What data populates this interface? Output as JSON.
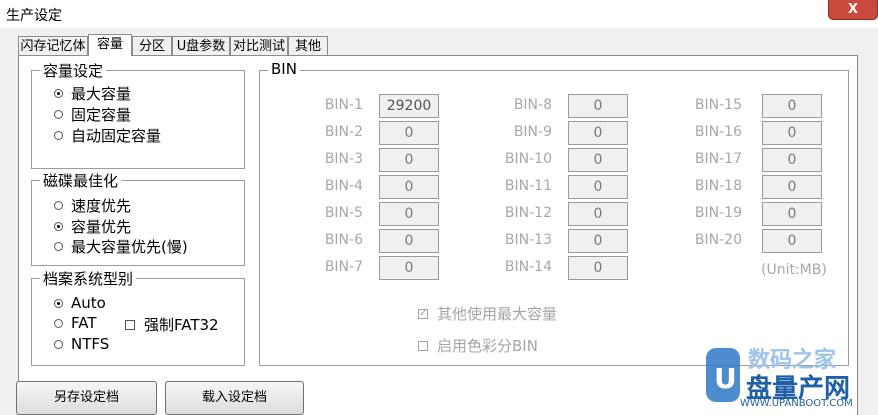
{
  "window": {
    "title": "生产设定",
    "close_glyph": "X"
  },
  "tabs": [
    "闪存记忆体",
    "容量",
    "分区",
    "U盘参数",
    "对比测试",
    "其他"
  ],
  "active_tab": 1,
  "capacity_group": {
    "title": "容量设定",
    "options": [
      "最大容量",
      "固定容量",
      "自动固定容量"
    ],
    "selected": 0
  },
  "optimize_group": {
    "title": "磁碟最佳化",
    "options": [
      "速度优先",
      "容量优先",
      "最大容量优先(慢)"
    ],
    "selected": 1
  },
  "fs_group": {
    "title": "档案系统型别",
    "options": [
      "Auto",
      "FAT",
      "NTFS"
    ],
    "selected": 0,
    "force_fat32_label": "强制FAT32"
  },
  "bin_group": {
    "title": "BIN",
    "bins": [
      {
        "label": "BIN-1",
        "value": "29200"
      },
      {
        "label": "BIN-2",
        "value": "0"
      },
      {
        "label": "BIN-3",
        "value": "0"
      },
      {
        "label": "BIN-4",
        "value": "0"
      },
      {
        "label": "BIN-5",
        "value": "0"
      },
      {
        "label": "BIN-6",
        "value": "0"
      },
      {
        "label": "BIN-7",
        "value": "0"
      },
      {
        "label": "BIN-8",
        "value": "0"
      },
      {
        "label": "BIN-9",
        "value": "0"
      },
      {
        "label": "BIN-10",
        "value": "0"
      },
      {
        "label": "BIN-11",
        "value": "0"
      },
      {
        "label": "BIN-12",
        "value": "0"
      },
      {
        "label": "BIN-13",
        "value": "0"
      },
      {
        "label": "BIN-14",
        "value": "0"
      },
      {
        "label": "BIN-15",
        "value": "0"
      },
      {
        "label": "BIN-16",
        "value": "0"
      },
      {
        "label": "BIN-17",
        "value": "0"
      },
      {
        "label": "BIN-18",
        "value": "0"
      },
      {
        "label": "BIN-19",
        "value": "0"
      },
      {
        "label": "BIN-20",
        "value": "0"
      }
    ],
    "unit_label": "(Unit:MB)",
    "use_max_label": "其他使用最大容量",
    "use_max_checked": true,
    "color_bin_label": "启用色彩分BIN",
    "color_bin_checked": false
  },
  "buttons": {
    "save_as": "另存设定档",
    "load": "载入设定档"
  },
  "watermark": {
    "line1": "数码之家",
    "line2": "盘量产网",
    "site": "WWW.UPANBOOT.COM"
  }
}
